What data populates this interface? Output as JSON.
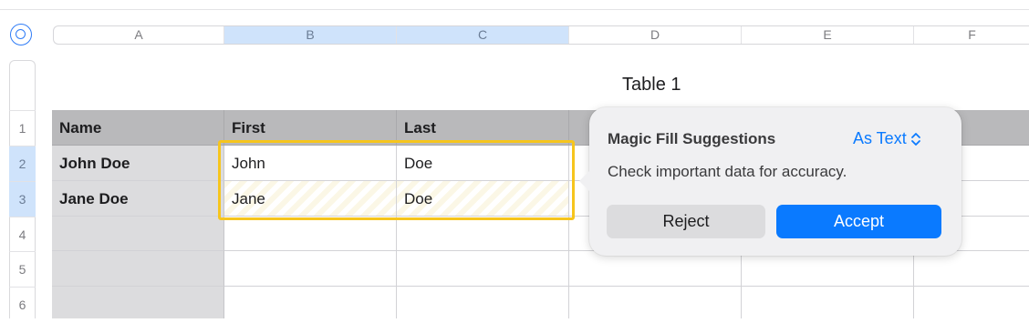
{
  "column_headers": [
    "A",
    "B",
    "C",
    "D",
    "E",
    "F"
  ],
  "selected_columns": [
    "B",
    "C"
  ],
  "row_headers": [
    "1",
    "2",
    "3",
    "4",
    "5",
    "6"
  ],
  "selected_rows": [
    "2",
    "3"
  ],
  "table_title": "Table 1",
  "table": {
    "header": [
      "Name",
      "First",
      "Last"
    ],
    "rows": [
      [
        "John Doe",
        "John",
        "Doe"
      ],
      [
        "Jane Doe",
        "Jane",
        "Doe"
      ],
      [
        "",
        "",
        ""
      ],
      [
        "",
        "",
        ""
      ],
      [
        "",
        "",
        ""
      ]
    ]
  },
  "popover": {
    "title": "Magic Fill Suggestions",
    "format_selector": "As Text",
    "format_icon": "chevron-up-down-icon",
    "message": "Check important data for accuracy.",
    "reject_label": "Reject",
    "accept_label": "Accept"
  },
  "colors": {
    "accent": "#0a7aff",
    "highlight_outline": "#f6c51d",
    "header_row_bg": "#b9b9bb",
    "header_column_bg": "#dcdcde",
    "selected_header_bg": "#cfe3fb"
  }
}
